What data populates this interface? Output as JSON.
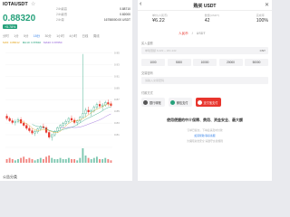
{
  "left": {
    "pair": "IOTAUSDT",
    "price": "0.88320",
    "change": "+5.78%",
    "stats": [
      {
        "label": "24h最高",
        "value": "0.88710"
      },
      {
        "label": "24h最低",
        "value": "0.82000"
      },
      {
        "label": "24h量",
        "value": "16758000.00 USDT"
      }
    ],
    "tabs": [
      "分时",
      "1分",
      "5分",
      "15分",
      "30分",
      "1小时",
      "4小时",
      "日线",
      "周线"
    ],
    "active_tab": "15分",
    "indicators": {
      "ma1": "MA5: 0.88012",
      "ma2": "MA10: 0.87840",
      "ma3": "MA30: 0.87650"
    },
    "bottom_label": "公告分类"
  },
  "right": {
    "title": "购买 USDT",
    "stats": [
      {
        "label": "单价(人民币)",
        "value": "¥6.22"
      },
      {
        "label": "数量(USDT)",
        "value": "42"
      },
      {
        "label": "完成率",
        "value": "100%"
      }
    ],
    "segment": {
      "on": "人民币",
      "sep": "/",
      "off": "USDT"
    },
    "field1_label": "买入金额",
    "field1_placeholder": "单笔限额 6.22¥ ~ 261.24¥",
    "field1_unit": "CNY",
    "quick_amounts": [
      "1000",
      "5000",
      "10000",
      "20000",
      "50000"
    ],
    "field2_label": "交易密码",
    "field2_placeholder": "请输入交易密码",
    "field3_label": "付款方式",
    "pay_methods": [
      "银行转账",
      "微信支付",
      "支付宝支付"
    ],
    "tagline": "使用便捷的中介保障、费用、资金安全、最大额",
    "notes": [
      "订单已提交，下单后请及时付款",
      "如需帮助 联系客服",
      "为保障资金安全 请遵守交易规则"
    ],
    "colors": {
      "accent": "#e8352d",
      "up": "#26a17b",
      "down": "#e8352d"
    }
  },
  "chart_data": {
    "type": "candlestick",
    "title": "IOTAUSDT",
    "ylim": [
      0.79,
      0.96
    ],
    "y_ticks": [
      0.95,
      0.93,
      0.91,
      0.89,
      0.87,
      0.85,
      0.83,
      0.81
    ],
    "ohlc": [
      [
        0.842,
        0.846,
        0.835,
        0.838
      ],
      [
        0.838,
        0.841,
        0.832,
        0.834
      ],
      [
        0.834,
        0.838,
        0.828,
        0.831
      ],
      [
        0.831,
        0.836,
        0.826,
        0.833
      ],
      [
        0.833,
        0.839,
        0.83,
        0.836
      ],
      [
        0.836,
        0.84,
        0.829,
        0.83
      ],
      [
        0.83,
        0.834,
        0.823,
        0.826
      ],
      [
        0.826,
        0.83,
        0.818,
        0.821
      ],
      [
        0.821,
        0.825,
        0.814,
        0.817
      ],
      [
        0.817,
        0.821,
        0.81,
        0.813
      ],
      [
        0.813,
        0.818,
        0.808,
        0.815
      ],
      [
        0.815,
        0.822,
        0.812,
        0.82
      ],
      [
        0.82,
        0.826,
        0.817,
        0.824
      ],
      [
        0.824,
        0.829,
        0.82,
        0.822
      ],
      [
        0.822,
        0.825,
        0.812,
        0.814
      ],
      [
        0.814,
        0.817,
        0.803,
        0.806
      ],
      [
        0.806,
        0.812,
        0.8,
        0.81
      ],
      [
        0.81,
        0.818,
        0.807,
        0.816
      ],
      [
        0.816,
        0.824,
        0.813,
        0.822
      ],
      [
        0.822,
        0.828,
        0.818,
        0.826
      ],
      [
        0.826,
        0.832,
        0.822,
        0.829
      ],
      [
        0.829,
        0.836,
        0.826,
        0.833
      ],
      [
        0.833,
        0.84,
        0.829,
        0.838
      ],
      [
        0.838,
        0.843,
        0.832,
        0.835
      ],
      [
        0.835,
        0.839,
        0.828,
        0.831
      ],
      [
        0.831,
        0.836,
        0.826,
        0.834
      ],
      [
        0.834,
        0.842,
        0.831,
        0.84
      ],
      [
        0.84,
        0.948,
        0.838,
        0.846
      ],
      [
        0.846,
        0.856,
        0.84,
        0.852
      ],
      [
        0.852,
        0.858,
        0.845,
        0.849
      ],
      [
        0.849,
        0.854,
        0.842,
        0.851
      ],
      [
        0.851,
        0.86,
        0.848,
        0.857
      ],
      [
        0.857,
        0.865,
        0.853,
        0.862
      ],
      [
        0.862,
        0.868,
        0.856,
        0.859
      ],
      [
        0.859,
        0.864,
        0.852,
        0.861
      ],
      [
        0.861,
        0.868,
        0.858,
        0.865
      ],
      [
        0.865,
        0.87,
        0.859,
        0.863
      ],
      [
        0.863,
        0.867,
        0.857,
        0.86
      ]
    ],
    "volume": [
      3,
      4,
      3,
      2,
      3,
      4,
      5,
      3,
      4,
      3,
      2,
      3,
      4,
      3,
      5,
      6,
      4,
      3,
      3,
      4,
      3,
      3,
      4,
      3,
      3,
      2,
      4,
      12,
      6,
      4,
      3,
      4,
      5,
      3,
      3,
      4,
      3,
      2
    ]
  }
}
